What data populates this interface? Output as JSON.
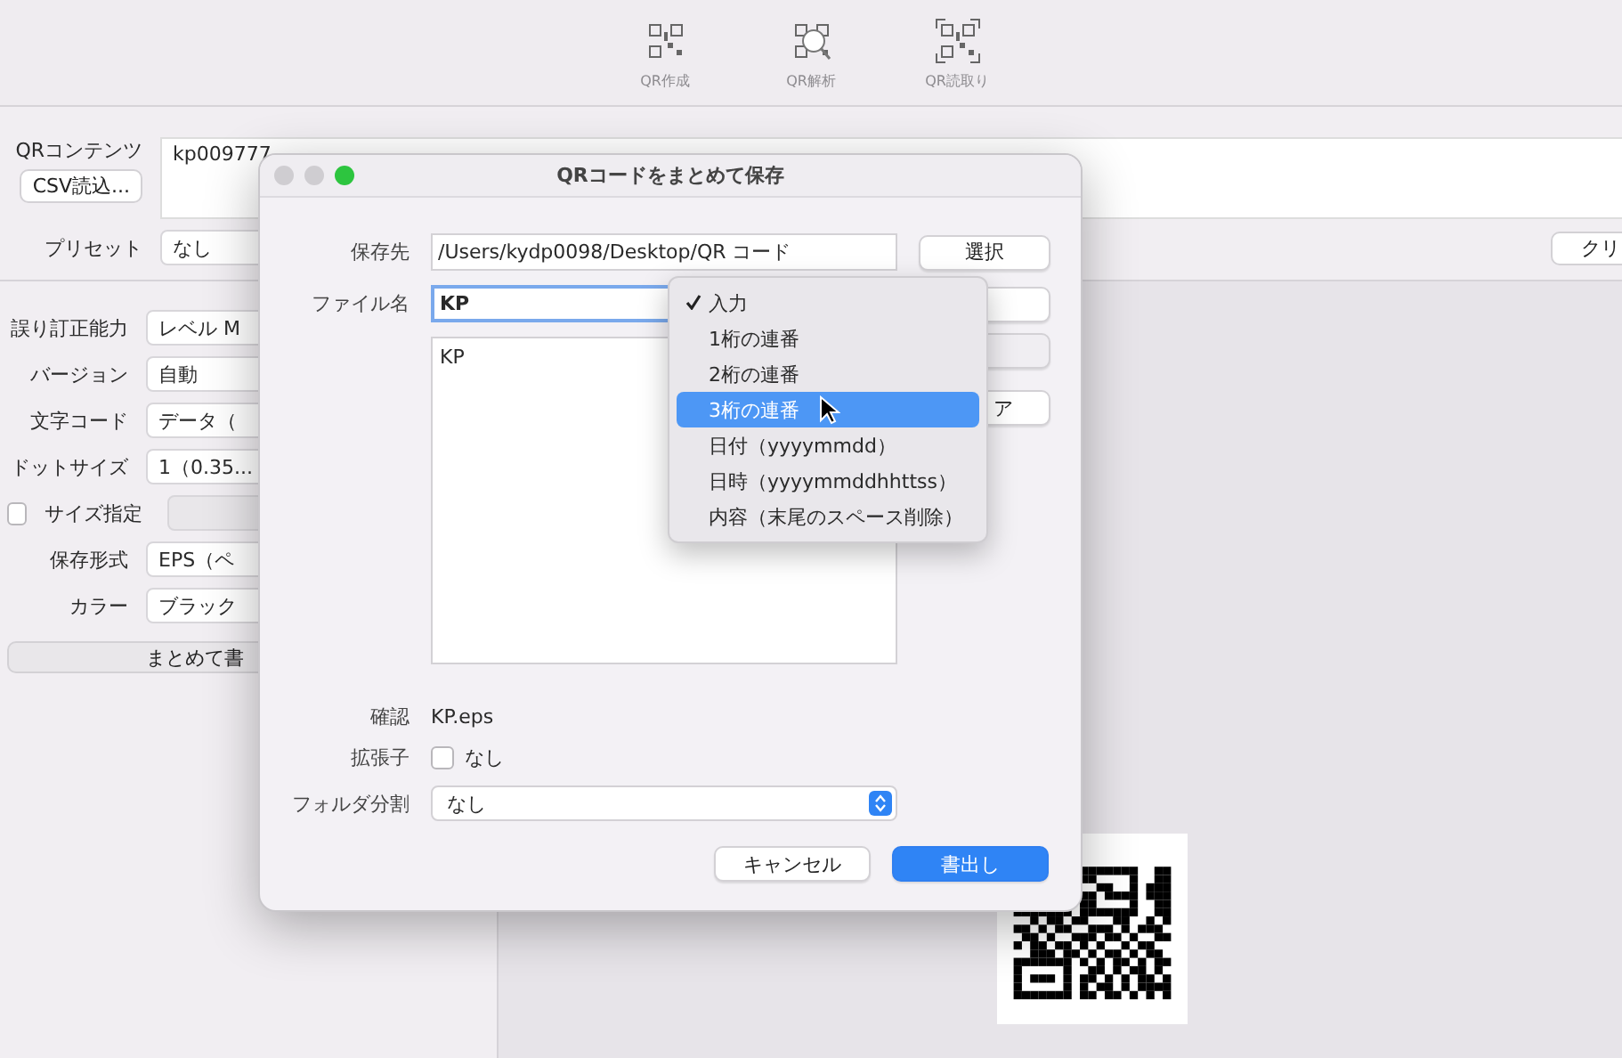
{
  "toolbar": [
    {
      "kind": "create",
      "label": "QR作成",
      "disabled": true
    },
    {
      "kind": "analyze",
      "label": "QR解析",
      "disabled": true
    },
    {
      "kind": "scan",
      "label": "QR読取り",
      "disabled": true
    }
  ],
  "main": {
    "contents_label": "QRコンテンツ",
    "contents_value": "kp009777",
    "csv_button": "CSV読込...",
    "preset_label": "プリセット",
    "preset_value": "なし",
    "clear_button": "クリ",
    "fields": [
      {
        "kind": "select",
        "label": "誤り訂正能力",
        "value": "レベル M"
      },
      {
        "kind": "select",
        "label": "バージョン",
        "value": "自動"
      },
      {
        "kind": "select",
        "label": "文字コード",
        "value": "データ（"
      },
      {
        "kind": "select",
        "label": "ドットサイズ",
        "value": "1（0.35..."
      },
      {
        "kind": "check",
        "label": "サイズ指定",
        "checked": false
      },
      {
        "kind": "select",
        "label": "保存形式",
        "value": "EPS（ペ"
      },
      {
        "kind": "select",
        "label": "カラー",
        "value": "ブラック"
      }
    ],
    "bulk_button": "まとめて書"
  },
  "dialog": {
    "title": "QRコードをまとめて保存",
    "dest_label": "保存先",
    "dest_value": "/Users/kydp0098/Desktop/QR コード",
    "choose_button": "選択",
    "filename_label": "ファイル名",
    "filename_value": "KP",
    "list_items": [
      "KP"
    ],
    "side_buttons": [
      {
        "disabled": false
      },
      {
        "disabled": true
      },
      {
        "label": "ア",
        "disabled": false
      }
    ],
    "confirm_label": "確認",
    "confirm_value": "KP.eps",
    "ext_label": "拡張子",
    "ext_checked": false,
    "ext_text": "なし",
    "split_label": "フォルダ分割",
    "split_value": "なし",
    "cancel_button": "キャンセル",
    "export_button": "書出し"
  },
  "menu": [
    {
      "label": "入力",
      "checked": true,
      "selected": false
    },
    {
      "label": "1桁の連番",
      "checked": false,
      "selected": false
    },
    {
      "label": "2桁の連番",
      "checked": false,
      "selected": false
    },
    {
      "label": "3桁の連番",
      "checked": false,
      "selected": true
    },
    {
      "label": "日付（yyyymmdd）",
      "checked": false,
      "selected": false
    },
    {
      "label": "日時（yyyymmddhhttss）",
      "checked": false,
      "selected": false
    },
    {
      "label": "内容（末尾のスペース削除）",
      "checked": false,
      "selected": false
    }
  ]
}
